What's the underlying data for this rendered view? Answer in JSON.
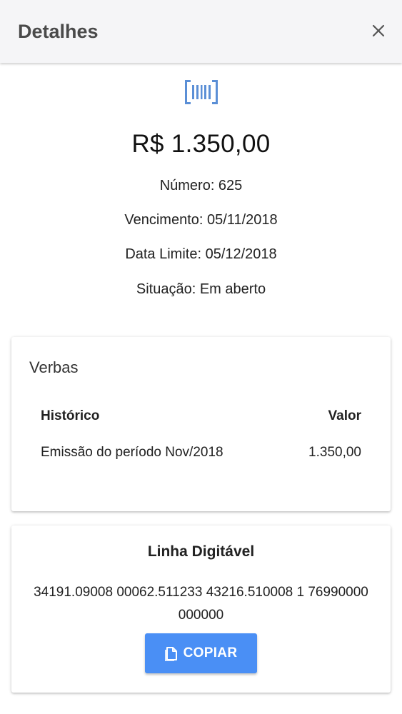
{
  "header": {
    "title": "Detalhes",
    "close_icon": "close-icon"
  },
  "summary": {
    "icon": "barcode-icon",
    "amount": "R$ 1.350,00",
    "numero": "Número: 625",
    "vencimento": "Vencimento: 05/11/2018",
    "data_limite": "Data Limite: 05/12/2018",
    "situacao": "Situação: Em aberto"
  },
  "verbas": {
    "title": "Verbas",
    "columns": [
      "Histórico",
      "Valor"
    ],
    "rows": [
      {
        "historico": "Emissão do período Nov/2018",
        "valor": "1.350,00"
      }
    ]
  },
  "linha_digitavel": {
    "title": "Linha Digitável",
    "code": "34191.09008 00062.511233 43216.510008 1 76990000000000",
    "copy_label": "COPIAR",
    "copy_icon": "copy-icon"
  },
  "colors": {
    "accent": "#4a8ff5",
    "icon_blue": "#5b8fd6",
    "header_bg": "#f5f5f7"
  }
}
